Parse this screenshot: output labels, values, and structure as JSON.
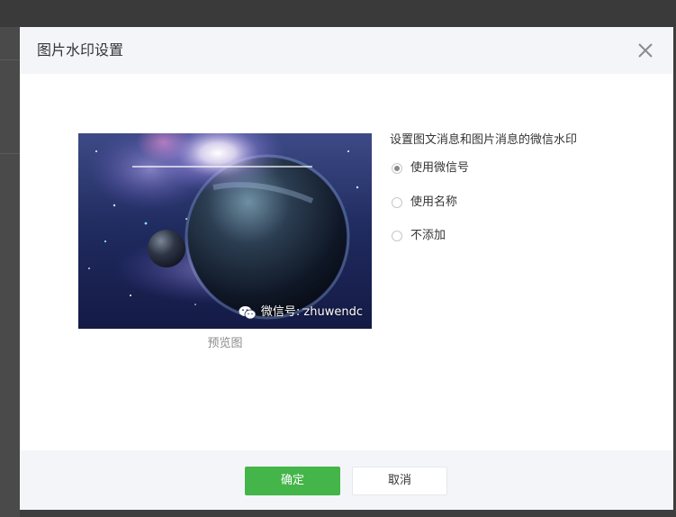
{
  "dialog": {
    "title": "图片水印设置",
    "close_icon": "close-icon"
  },
  "preview": {
    "watermark_text": "微信号: zhuwendc",
    "watermark_icon": "wechat-icon",
    "caption": "预览图"
  },
  "options": {
    "title": "设置图文消息和图片消息的微信水印",
    "items": [
      {
        "label": "使用微信号",
        "checked": true
      },
      {
        "label": "使用名称",
        "checked": false
      },
      {
        "label": "不添加",
        "checked": false
      }
    ]
  },
  "footer": {
    "confirm_label": "确定",
    "cancel_label": "取消"
  },
  "colors": {
    "primary": "#44b549",
    "header_bg": "#f4f5f9",
    "overlay": "#3e3e3e"
  }
}
